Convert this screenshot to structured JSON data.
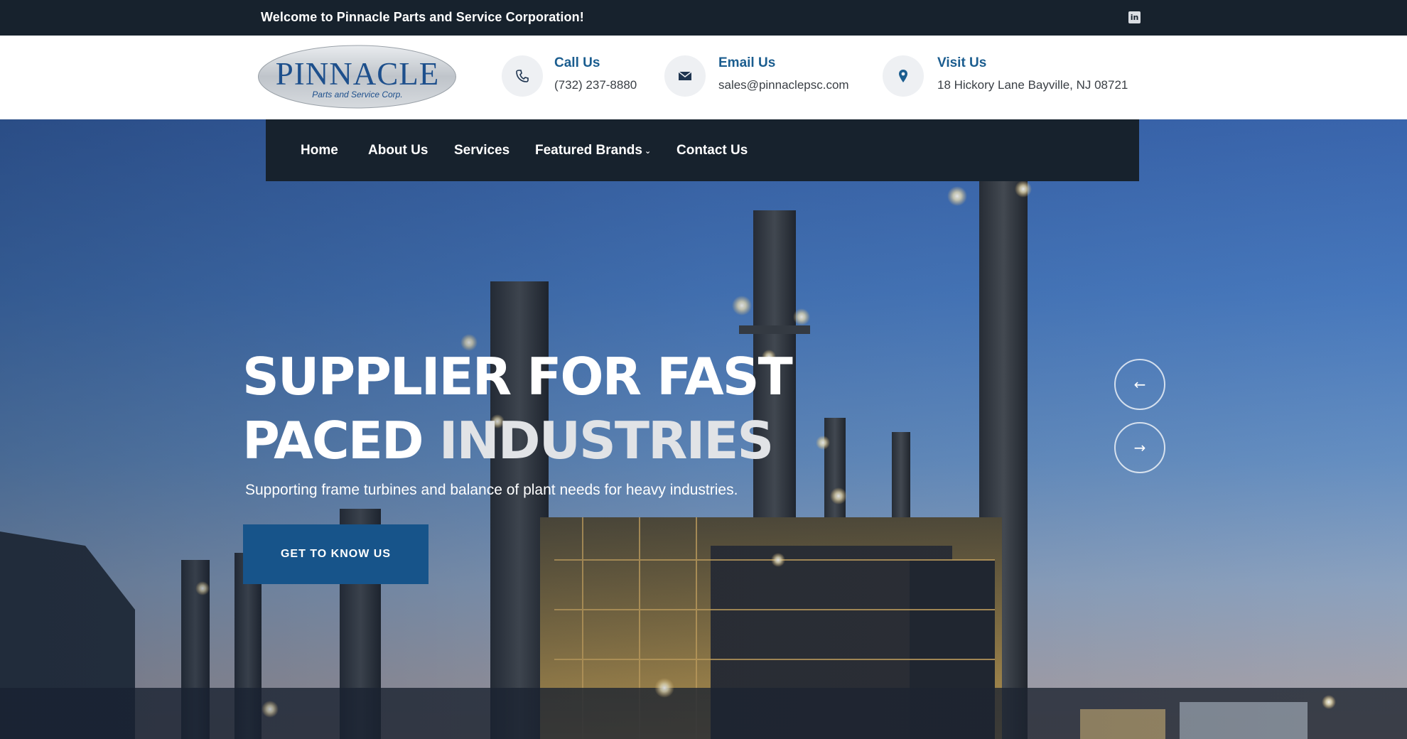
{
  "topbar": {
    "welcome": "Welcome to Pinnacle Parts and Service Corporation!",
    "social_icon": "linkedin-icon",
    "social_glyph": "in"
  },
  "header": {
    "logo": {
      "name": "PINNACLE",
      "tagline": "Parts and Service Corp."
    },
    "call": {
      "icon": "phone-icon",
      "title": "Call Us",
      "value": "(732) 237-8880"
    },
    "email": {
      "icon": "envelope-icon",
      "title": "Email Us",
      "value": "sales@pinnaclepsc.com"
    },
    "visit": {
      "icon": "map-pin-icon",
      "title": "Visit Us",
      "value": "18 Hickory Lane Bayville, NJ 08721"
    }
  },
  "nav": {
    "items": [
      {
        "label": "Home"
      },
      {
        "label": "About Us"
      },
      {
        "label": "Services"
      },
      {
        "label": "Featured Brands",
        "has_dropdown": true
      },
      {
        "label": "Contact Us"
      }
    ]
  },
  "hero": {
    "line1": "SUPPLIER FOR FAST",
    "line2_bold": "PACED",
    "line2_light": "INDUSTRIES",
    "subtitle": "Supporting frame turbines and balance of plant needs for heavy industries.",
    "cta_label": "GET TO KNOW US",
    "prev_glyph": "←",
    "next_glyph": "→"
  },
  "colors": {
    "dark": "#17222d",
    "accent_blue": "#1b5d8f",
    "cta_blue": "#17548a"
  }
}
